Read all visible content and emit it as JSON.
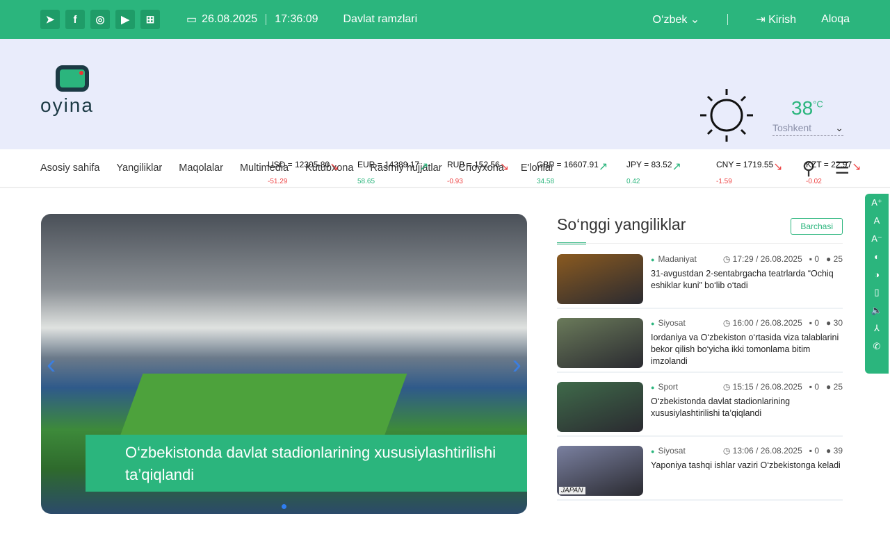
{
  "topbar": {
    "social": [
      {
        "icon": "telegram-icon",
        "glyph": "➤"
      },
      {
        "icon": "facebook-icon",
        "glyph": "f"
      },
      {
        "icon": "instagram-icon",
        "glyph": "◎"
      },
      {
        "icon": "youtube-icon",
        "glyph": "▶"
      },
      {
        "icon": "sitemap-icon",
        "glyph": "⊞"
      }
    ],
    "date": "26.08.2025",
    "time": "17:36:09",
    "state_symbols": "Davlat ramzlari",
    "language": "O‘zbek",
    "login": "Kirish",
    "contact": "Aloqa"
  },
  "logo": {
    "text": "oyina"
  },
  "weather": {
    "temp": "38",
    "unit": "°C",
    "city": "Toshkent"
  },
  "rates": [
    {
      "label": "USD = 12305.80",
      "delta": "-51.29",
      "dir": "down"
    },
    {
      "label": "EUR = 14389.17",
      "delta": "58.65",
      "dir": "up"
    },
    {
      "label": "RUB = 152.56",
      "delta": "-0.93",
      "dir": "down"
    },
    {
      "label": "GBP = 16607.91",
      "delta": "34.58",
      "dir": "up"
    },
    {
      "label": "JPY = 83.52",
      "delta": "0.42",
      "dir": "up"
    },
    {
      "label": "CNY = 1719.55",
      "delta": "-1.59",
      "dir": "down"
    },
    {
      "label": "KZT = 22.97",
      "delta": "-0.02",
      "dir": "down"
    }
  ],
  "nav": [
    "Asosiy sahifa",
    "Yangiliklar",
    "Maqolalar",
    "Multimedia",
    "Kutubxona",
    "Rasmiy hujjatlar",
    "Choyxona",
    "E'lonlar"
  ],
  "slider": {
    "caption": "O‘zbekistonda davlat stadionlarining xususiylashtirilishi ta’qiqlandi"
  },
  "latest": {
    "title": "So‘nggi yangiliklar",
    "all": "Barchasi",
    "items": [
      {
        "cat": "Madaniyat",
        "time": "17:29 / 26.08.2025",
        "comments": "0",
        "views": "25",
        "title": "31-avgustdan 2-sentabrgacha teatrlarda “Ochiq eshiklar kuni” bo‘lib o‘tadi",
        "thumb": "#8a5a20"
      },
      {
        "cat": "Siyosat",
        "time": "16:00 / 26.08.2025",
        "comments": "0",
        "views": "30",
        "title": "Iordaniya va O‘zbekiston o‘rtasida viza talablarini bekor qilish bo‘yicha ikki tomonlama bitim imzolandi",
        "thumb": "#6a7a5a"
      },
      {
        "cat": "Sport",
        "time": "15:15 / 26.08.2025",
        "comments": "0",
        "views": "25",
        "title": "O‘zbekistonda davlat stadionlarining xususiylashtirilishi ta’qiqlandi",
        "thumb": "#3f6a4a"
      },
      {
        "cat": "Siyosat",
        "time": "13:06 / 26.08.2025",
        "comments": "0",
        "views": "39",
        "title": "Yaponiya tashqi ishlar vaziri O‘zbekistonga keladi",
        "thumb": "#7a80a0",
        "label": "JAPAN"
      }
    ]
  },
  "tools": [
    "A⁺",
    "A",
    "A⁻",
    "◐",
    "◑",
    "▯",
    "🔈",
    "⅄",
    "✆"
  ]
}
